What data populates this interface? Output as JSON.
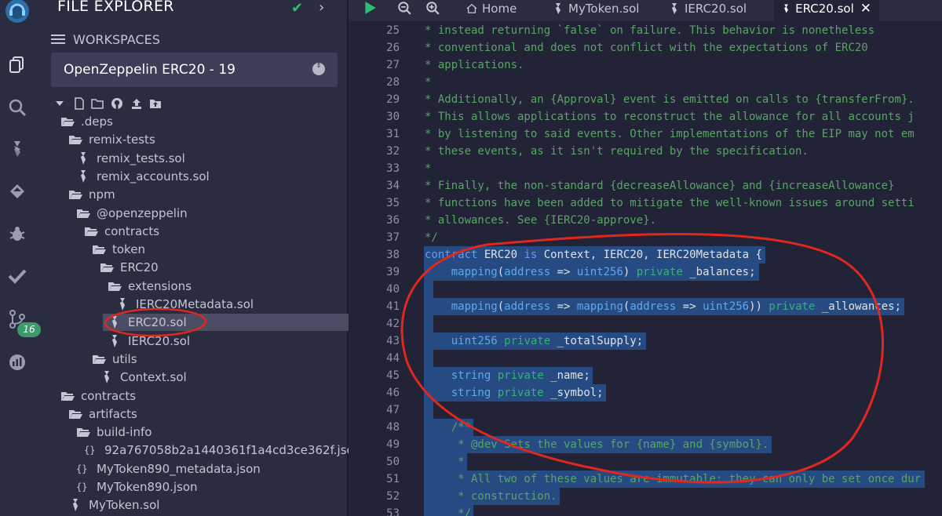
{
  "explorer": {
    "title": "FILE EXPLORER",
    "workspaces_label": "WORKSPACES",
    "workspace_selected": "OpenZeppelin ERC20 - 19",
    "git_badge": "16",
    "tree": [
      {
        "label": ".deps",
        "type": "folder-open"
      },
      {
        "label": "remix-tests",
        "type": "folder-open"
      },
      {
        "label": "remix_tests.sol",
        "type": "sol"
      },
      {
        "label": "remix_accounts.sol",
        "type": "sol"
      },
      {
        "label": "npm",
        "type": "folder-open"
      },
      {
        "label": "@openzeppelin",
        "type": "folder-open"
      },
      {
        "label": "contracts",
        "type": "folder-open"
      },
      {
        "label": "token",
        "type": "folder-open"
      },
      {
        "label": "ERC20",
        "type": "folder-open"
      },
      {
        "label": "extensions",
        "type": "folder-open"
      },
      {
        "label": "IERC20Metadata.sol",
        "type": "sol"
      },
      {
        "label": "ERC20.sol",
        "type": "sol",
        "selected": true
      },
      {
        "label": "IERC20.sol",
        "type": "sol"
      },
      {
        "label": "utils",
        "type": "folder-open"
      },
      {
        "label": "Context.sol",
        "type": "sol"
      },
      {
        "label": "contracts",
        "type": "folder-open"
      },
      {
        "label": "artifacts",
        "type": "folder-open"
      },
      {
        "label": "build-info",
        "type": "folder-open"
      },
      {
        "label": "92a767058b2a1440361f1a4cd3ce362f.json",
        "type": "json"
      },
      {
        "label": "MyToken890_metadata.json",
        "type": "json"
      },
      {
        "label": "MyToken890.json",
        "type": "json"
      },
      {
        "label": "MyToken.sol",
        "type": "sol"
      }
    ]
  },
  "tabs": {
    "home": "Home",
    "items": [
      "MyToken.sol",
      "IERC20.sol",
      "ERC20.sol"
    ],
    "active": "ERC20.sol"
  },
  "editor": {
    "lines": [
      {
        "n": "25",
        "text": "* instead returning `false` on failure. This behavior is nonetheless"
      },
      {
        "n": "26",
        "text": "* conventional and does not conflict with the expectations of ERC20"
      },
      {
        "n": "27",
        "text": "* applications."
      },
      {
        "n": "28",
        "text": "*"
      },
      {
        "n": "29",
        "text": "* Additionally, an {Approval} event is emitted on calls to {transferFrom}."
      },
      {
        "n": "30",
        "text": "* This allows applications to reconstruct the allowance for all accounts j"
      },
      {
        "n": "31",
        "text": "* by listening to said events. Other implementations of the EIP may not em"
      },
      {
        "n": "32",
        "text": "* these events, as it isn't required by the specification."
      },
      {
        "n": "33",
        "text": "*"
      },
      {
        "n": "34",
        "text": "* Finally, the non-standard {decreaseAllowance} and {increaseAllowance}"
      },
      {
        "n": "35",
        "text": "* functions have been added to mitigate the well-known issues around setti"
      },
      {
        "n": "36",
        "text": "* allowances. See {IERC20-approve}."
      },
      {
        "n": "37",
        "text": "*/"
      },
      {
        "n": "38",
        "text": "contract ERC20 is Context, IERC20, IERC20Metadata {"
      },
      {
        "n": "39",
        "text": "    mapping(address => uint256) private _balances;"
      },
      {
        "n": "40",
        "text": ""
      },
      {
        "n": "41",
        "text": "    mapping(address => mapping(address => uint256)) private _allowances;"
      },
      {
        "n": "42",
        "text": ""
      },
      {
        "n": "43",
        "text": "    uint256 private _totalSupply;"
      },
      {
        "n": "44",
        "text": ""
      },
      {
        "n": "45",
        "text": "    string private _name;"
      },
      {
        "n": "46",
        "text": "    string private _symbol;"
      },
      {
        "n": "47",
        "text": ""
      },
      {
        "n": "48",
        "text": "    /**"
      },
      {
        "n": "49",
        "text": "     * @dev Sets the values for {name} and {symbol}."
      },
      {
        "n": "50",
        "text": "     *"
      },
      {
        "n": "51",
        "text": "     * All two of these values are immutable: they can only be set once dur"
      },
      {
        "n": "52",
        "text": "     * construction."
      },
      {
        "n": "53",
        "text": "     */"
      }
    ]
  },
  "colors": {
    "background": "#222336",
    "sidebar": "#2a2c3f",
    "selection": "#264a82",
    "comment": "#5aa467",
    "annotation_red": "#e0281e",
    "accent_green": "#2fbc73"
  }
}
